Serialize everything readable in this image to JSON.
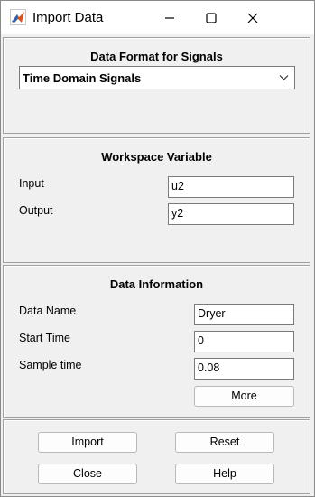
{
  "window": {
    "title": "Import Data"
  },
  "format_panel": {
    "title": "Data Format for Signals",
    "selected": "Time Domain Signals"
  },
  "workspace_panel": {
    "title": "Workspace Variable",
    "input_label": "Input",
    "input_value": "u2",
    "output_label": "Output",
    "output_value": "y2"
  },
  "info_panel": {
    "title": "Data Information",
    "name_label": "Data Name",
    "name_value": "Dryer",
    "start_label": "Start Time",
    "start_value": "0",
    "sample_label": "Sample time",
    "sample_value": "0.08",
    "more_label": "More"
  },
  "buttons": {
    "import": "Import",
    "reset": "Reset",
    "close": "Close",
    "help": "Help"
  }
}
